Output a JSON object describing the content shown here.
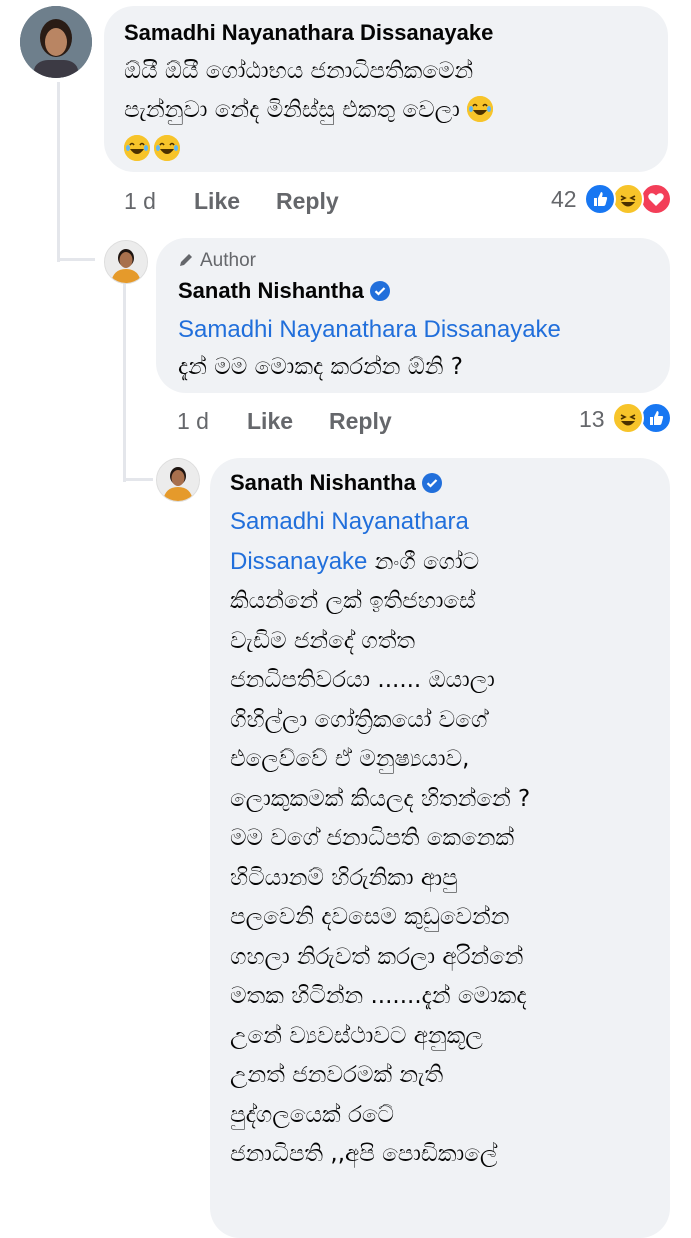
{
  "comment1": {
    "author": "Samadhi Nayanathara Dissanayake",
    "lines": [
      "ඕයී ඕයී ගෝඨාභය ජනාධිපතිකමෙන්",
      "පැන්නුවා නේද මිනිස්සු එකතු වෙලා"
    ],
    "time": "1 d",
    "like_label": "Like",
    "reply_label": "Reply",
    "reaction_count": "42",
    "reactions": [
      "like-reaction",
      "haha-reaction",
      "love-reaction"
    ],
    "emoji": "laughing-emoji"
  },
  "reply1": {
    "badge_icon": "pencil-icon",
    "author_tag": "Author",
    "author": "Sanath Nishantha",
    "mention": "Samadhi Nayanathara Dissanayake",
    "text": "දැන් මම මොකද කරන්න ඕනි ?",
    "time": "1 d",
    "like_label": "Like",
    "reply_label": "Reply",
    "reaction_count": "13",
    "reactions": [
      "haha-reaction",
      "like-reaction"
    ]
  },
  "reply2": {
    "author": "Sanath Nishantha",
    "mention_line1": "Samadhi Nayanathara",
    "mention_line2": "Dissanayake",
    "line2_rest": " නංගී ගෝට",
    "lines": [
      "කියන්නේ ලක් ඉතිජහාසේ",
      "වැඩිම ජන්දේ ගත්ත",
      "ජනධිපතිවරයා ...... ඔයාලා",
      "ගිහිල්ලා ගෝත්‍රිකයෝ වගේ",
      "එලෙව්වේ ඒ මනුෂ්‍යයාව,",
      "ලොකුකමක් කියලද හිතන්නේ ?",
      "මම වගේ ජනාධිපති කෙනෙක්",
      "හිටියානම් හිරුනිකා ආපු",
      "පලවෙනි දවසෙම කුඩුවෙන්න",
      "ගහලා නිරුවත් කරලා අරින්නේ",
      "මතක හිටින්න .......දැන් මොකද",
      "උනේ ව්‍යවස්ථාවට අනුකූල",
      "උනත් ජනවරමක් නැති",
      "පුද්ගලයෙක් රටේ",
      "ජනාධිපති ,,අපි පොඩිකාලේ"
    ]
  }
}
